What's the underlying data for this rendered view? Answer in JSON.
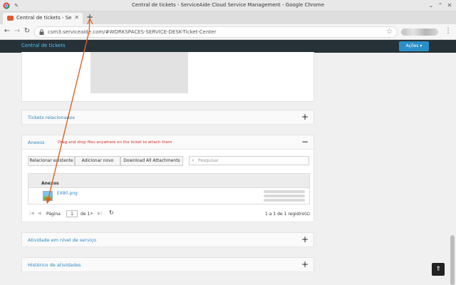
{
  "window": {
    "title": "Central de tickets - ServiceAide Cloud Service Management - Google Chrome"
  },
  "tabs": [
    {
      "label": "Central de tickets - ServiceAi"
    }
  ],
  "address_bar": {
    "url": "csm3.serviceaide.com/#WORKSPACES-SERVICE-DESK-Ticket-Center"
  },
  "app_header": {
    "brand": "Central de tickets",
    "actions_button": "Ações ▾"
  },
  "panels": {
    "related": {
      "title": "Tickets relacionados",
      "toggle": "+"
    },
    "attachments": {
      "title": "Anexos",
      "toggle": "−",
      "hint": "Drag and drop files anywhere on the ticket to attach them",
      "buttons": [
        "Relacionar existente",
        "Adicionar novo",
        "Download All Attachments"
      ],
      "search_placeholder": "Pesquisar",
      "grid_header": "Anexos",
      "file_name": "EX80.png",
      "pager": {
        "page_label": "Página",
        "page_value": "1",
        "of_label": "de 1",
        "summary": "1 a 1 de 1 registro(s)"
      }
    },
    "sla": {
      "title": "Atividade em nível de serviço",
      "toggle": "+"
    },
    "history": {
      "title": "Histórico de atividades",
      "toggle": "+"
    }
  },
  "colors": {
    "header_bg": "#263238",
    "accent": "#2a87c1",
    "action_button": "#2a8fc7",
    "hint_red": "#d32f2f",
    "annotation_arrow": "#e06020"
  }
}
